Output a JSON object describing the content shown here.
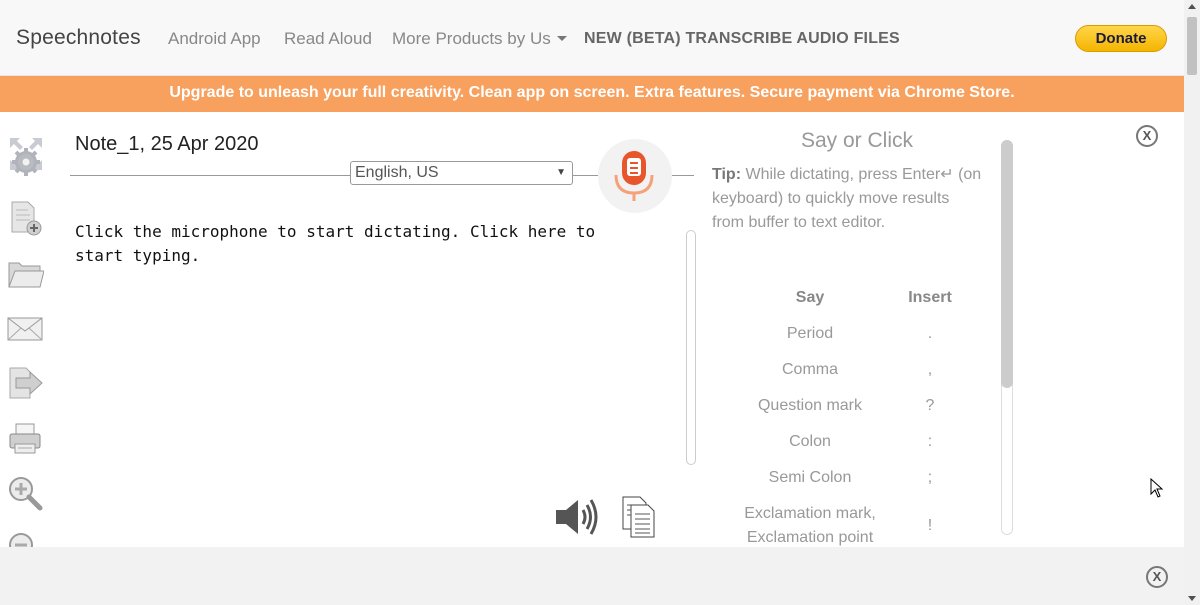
{
  "nav": {
    "brand": "Speechnotes",
    "android_app": "Android App",
    "read_aloud": "Read Aloud",
    "more_products": "More Products by Us",
    "transcribe": "NEW (BETA) TRANSCRIBE AUDIO FILES",
    "donate": "Donate"
  },
  "banner": {
    "text": "Upgrade to unleash your full creativity. Clean app on screen. Extra features. Secure payment via Chrome Store."
  },
  "toolbar": {
    "icons": [
      "fullscreen-settings-icon",
      "new-note-icon",
      "open-folder-icon",
      "email-icon",
      "export-icon",
      "print-icon",
      "zoom-in-icon",
      "zoom-out-icon"
    ]
  },
  "note": {
    "title": "Note_1, 25 Apr 2020",
    "language": "English, US",
    "editor_text": "Click the microphone to start dictating. Click here to start typing."
  },
  "panel": {
    "title": "Say or Click",
    "tip_label": "Tip:",
    "tip_text": " While dictating, press Enter↵ (on keyboard) to quickly move results from buffer to text editor.",
    "col_say": "Say",
    "col_insert": "Insert",
    "commands": [
      {
        "say": "Period",
        "insert": "."
      },
      {
        "say": "Comma",
        "insert": ","
      },
      {
        "say": "Question mark",
        "insert": "?"
      },
      {
        "say": "Colon",
        "insert": ":"
      },
      {
        "say": "Semi Colon",
        "insert": ";"
      },
      {
        "say": "Exclamation mark,",
        "say2": "Exclamation point",
        "insert": "!"
      }
    ],
    "close": "X"
  },
  "bottom": {
    "close": "X"
  },
  "colors": {
    "banner": "#f8a05e",
    "mic_accent": "#e8572c",
    "donate": "#f5b400"
  }
}
